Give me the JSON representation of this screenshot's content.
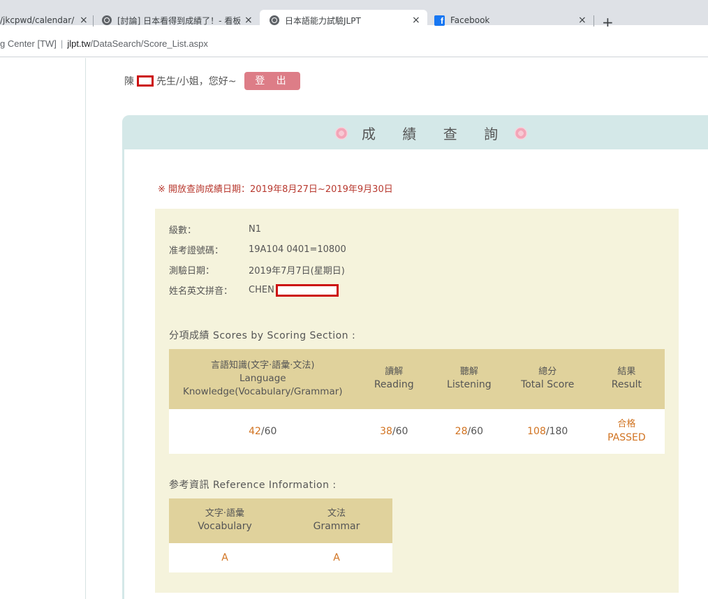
{
  "browser": {
    "tabs": [
      {
        "label": "/jkcpwd/calendar/",
        "active": false
      },
      {
        "label": "[討論] 日本看得到成績了！- 看板",
        "active": false
      },
      {
        "label": "日本語能力試驗JLPT",
        "active": true
      },
      {
        "label": "Facebook",
        "active": false
      }
    ],
    "new_tab": "+",
    "close_glyph": "×",
    "address": {
      "site": "g Center [TW]",
      "host": "jlpt.tw",
      "path": "/DataSearch/Score_List.aspx"
    }
  },
  "greeting": {
    "surname": "陳",
    "suffix": "先生/小姐，您好~",
    "logout_label": "登 出"
  },
  "panel": {
    "title": "成 績 查 詢",
    "notice": "※ 開放查詢成績日期：2019年8月27日~2019年9月30日"
  },
  "info": {
    "level_label": "級數：",
    "level": "N1",
    "reg_label": "准考證號碼：",
    "reg": "19A104 0401=10800",
    "date_label": "測驗日期：",
    "date": "2019年7月7日(星期日)",
    "name_label": "姓名英文拼音：",
    "name": "CHEN"
  },
  "scores": {
    "section_title": "分項成績 Scores by Scoring Section :",
    "headers": [
      {
        "zh": "言語知識(文字·語彙·文法)",
        "en": "Language Knowledge(Vocabulary/Grammar)"
      },
      {
        "zh": "讀解",
        "en": "Reading"
      },
      {
        "zh": "聽解",
        "en": "Listening"
      },
      {
        "zh": "總分",
        "en": "Total Score"
      },
      {
        "zh": "結果",
        "en": "Result"
      }
    ],
    "values": [
      {
        "score": "42",
        "max": "/60"
      },
      {
        "score": "38",
        "max": "/60"
      },
      {
        "score": "28",
        "max": "/60"
      },
      {
        "score": "108",
        "max": "/180"
      }
    ],
    "result_zh": "合格",
    "result_en": "PASSED"
  },
  "reference": {
    "section_title": "参考資訊 Reference Information :",
    "headers": [
      {
        "zh": "文字·語彙",
        "en": "Vocabulary"
      },
      {
        "zh": "文法",
        "en": "Grammar"
      }
    ],
    "values": [
      "A",
      "A"
    ]
  },
  "colors": {
    "panel_header": "#d4e8e8",
    "info_bg": "#f5f3dc",
    "table_header": "#e0d29c",
    "score_accent": "#d17321",
    "logout_button": "#dd7d87",
    "notice_text": "#b8392f",
    "redaction": "#cc1111"
  }
}
